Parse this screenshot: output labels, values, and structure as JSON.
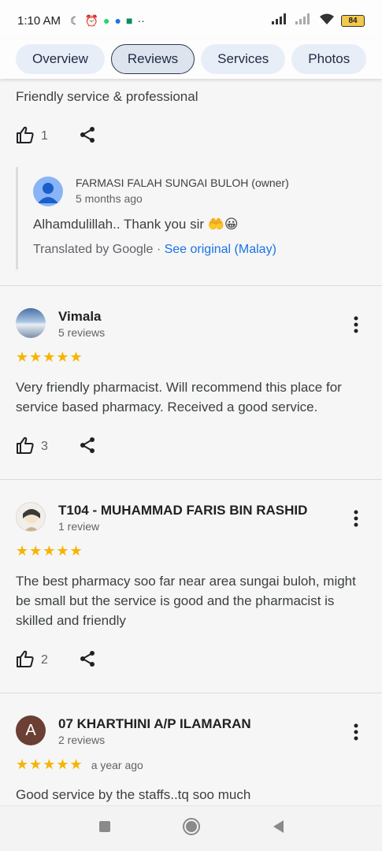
{
  "status_bar": {
    "time": "1:10 AM",
    "battery": "84"
  },
  "tabs": [
    {
      "label": "Overview"
    },
    {
      "label": "Reviews"
    },
    {
      "label": "Services"
    },
    {
      "label": "Photos"
    }
  ],
  "partial_review": {
    "text": "Friendly service & professional",
    "likes": "1"
  },
  "owner_reply": {
    "name": "FARMASI FALAH SUNGAI BULOH (owner)",
    "time": "5 months ago",
    "text": "Alhamdulillah.. Thank you sir 🤲😀",
    "translated_by": "Translated by Google",
    "separator": " · ",
    "see_original": "See original (Malay)"
  },
  "reviews": [
    {
      "name": "Vimala",
      "count": "5 reviews",
      "stars": "★★★★★",
      "date": "",
      "text": "Very friendly pharmacist. Will recommend this place for service based pharmacy. Received a good service.",
      "likes": "3"
    },
    {
      "name": "T104 - MUHAMMAD FARIS BIN RASHID",
      "count": "1 review",
      "stars": "★★★★★",
      "date": "",
      "text": "The best pharmacy soo far near area sungai buloh, might be small but the service is good and the pharmacist is skilled and friendly",
      "likes": "2"
    },
    {
      "name": "07 KHARTHINI A/P ILAMARAN",
      "initial": "A",
      "count": "2 reviews",
      "stars": "★★★★★",
      "date": "a year ago",
      "text": "Good service by the staffs..tq soo much"
    }
  ],
  "colors": {
    "star": "#f6b400",
    "link": "#1a73e8",
    "tab_bg": "#e8eef8",
    "avatar_brown": "#6b3f33"
  },
  "icons": [
    "thumbs-up-icon",
    "share-icon",
    "more-vert-icon",
    "person-icon",
    "stop-square-icon",
    "home-circle-icon",
    "back-triangle-icon"
  ]
}
